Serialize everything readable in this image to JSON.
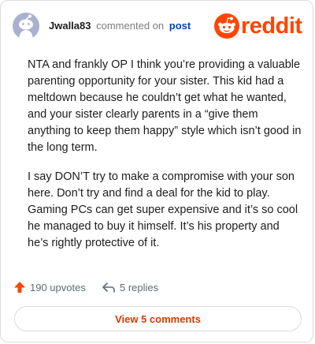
{
  "header": {
    "username": "Jwalla83",
    "action_text": "commented on",
    "post_link": "post",
    "logo_text": "reddit"
  },
  "comment": {
    "paragraphs": [
      "NTA and frankly OP I think you’re providing a valuable parenting opportunity for your sister. This kid had a meltdown because he couldn’t get what he wanted, and your sister clearly parents in a “give them anything to keep them happy” style which isn’t good in the long term.",
      "I say DON’T try to make a compromise with your son here. Don’t try and find a deal for the kid to play. Gaming PCs can get super expensive and it’s so cool he managed to buy it himself. It’s his property and he’s rightly protective of it."
    ]
  },
  "actions": {
    "upvotes_label": "190 upvotes",
    "replies_label": "5 replies"
  },
  "footer": {
    "view_comments_label": "View 5 comments"
  },
  "colors": {
    "brand": "#ff4500",
    "link": "#0045ac",
    "button_text": "#d93a00"
  },
  "icons": {
    "avatar": "snoo-avatar-icon",
    "logo": "reddit-logo-icon",
    "upvote": "upvote-arrow-icon",
    "reply": "reply-arrow-icon"
  }
}
